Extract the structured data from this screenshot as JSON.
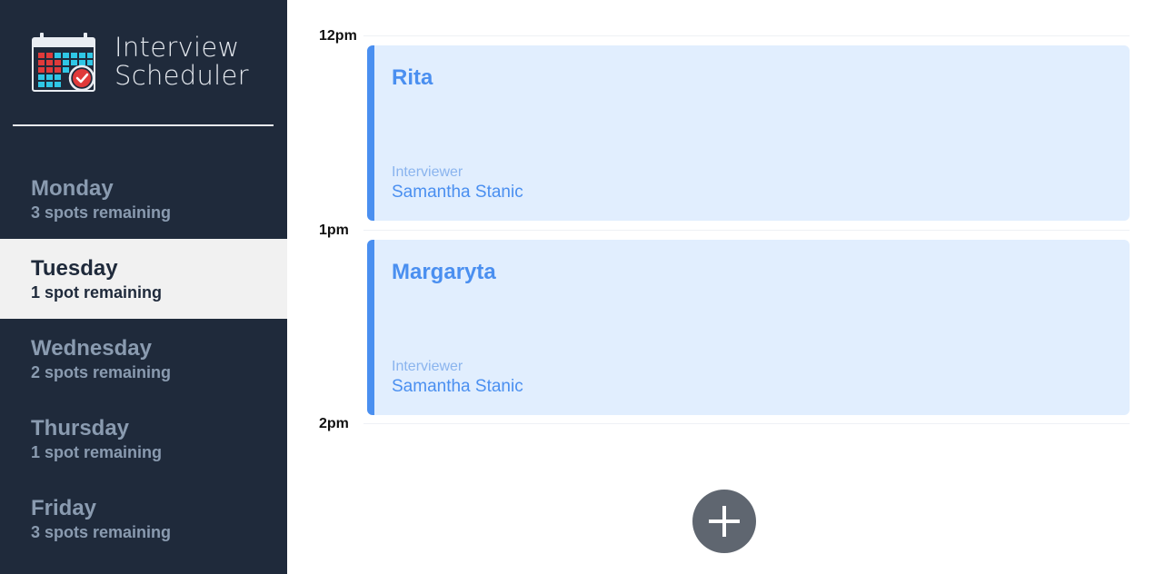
{
  "brand": {
    "title_line1": "Interview",
    "title_line2": "Scheduler",
    "logo_icon": "calendar-check-icon"
  },
  "sidebar": {
    "days": [
      {
        "name": "Monday",
        "spots": "3 spots remaining",
        "selected": false
      },
      {
        "name": "Tuesday",
        "spots": "1 spot remaining",
        "selected": true
      },
      {
        "name": "Wednesday",
        "spots": "2 spots remaining",
        "selected": false
      },
      {
        "name": "Thursday",
        "spots": "1 spot remaining",
        "selected": false
      },
      {
        "name": "Friday",
        "spots": "3 spots remaining",
        "selected": false
      }
    ]
  },
  "schedule": {
    "times": [
      "12pm",
      "1pm",
      "2pm"
    ],
    "appointments": [
      {
        "student": "Rita",
        "interviewer_label": "Interviewer",
        "interviewer": "Samantha Stanic"
      },
      {
        "student": "Margaryta",
        "interviewer_label": "Interviewer",
        "interviewer": "Samantha Stanic"
      }
    ],
    "add_button_icon": "plus-icon"
  },
  "colors": {
    "sidebar_bg": "#1f2a3b",
    "selected_day_bg": "#f1f1f1",
    "appointment_bg": "#e1eefe",
    "appointment_accent": "#4a8ff0",
    "add_button_bg": "#5f6670"
  }
}
